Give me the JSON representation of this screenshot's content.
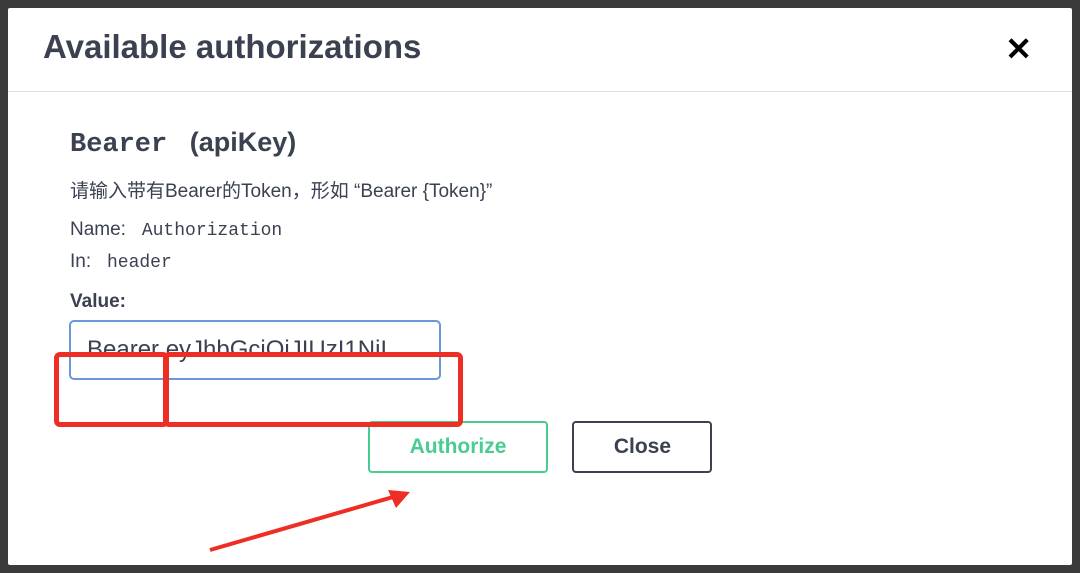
{
  "modal": {
    "title": "Available authorizations",
    "closeSymbol": "✕"
  },
  "auth": {
    "name": "Bearer",
    "typeLabel": "(apiKey)",
    "description": "请输入带有Bearer的Token，形如 “Bearer {Token}”",
    "nameLabel": "Name:",
    "nameValue": "Authorization",
    "inLabel": "In:",
    "inValue": "header",
    "valueLabel": "Value:",
    "valueInput": "Bearer eyJhbGciOiJIUzI1NiI"
  },
  "buttons": {
    "authorize": "Authorize",
    "close": "Close"
  }
}
